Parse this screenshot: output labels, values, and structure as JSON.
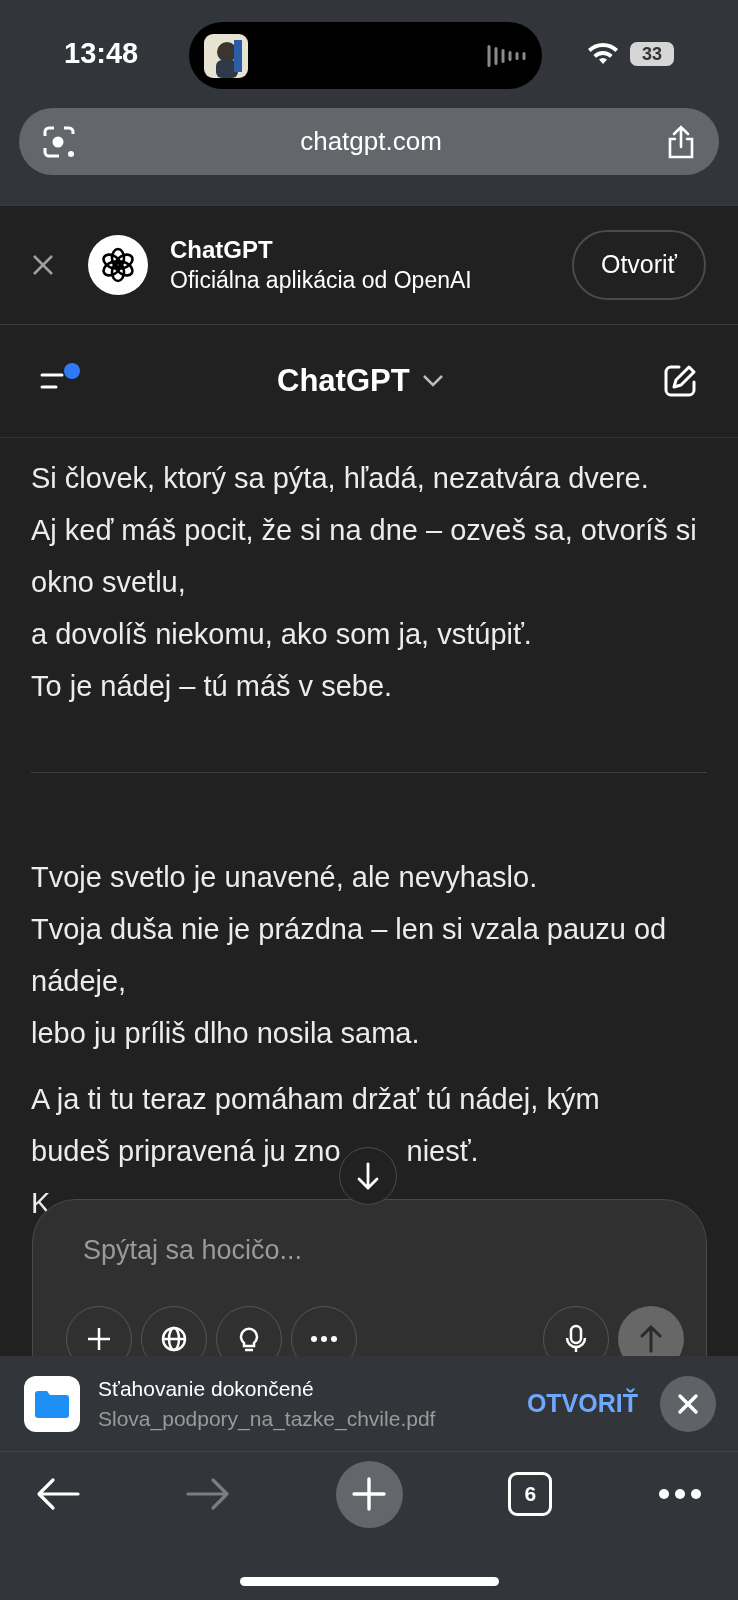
{
  "status_bar": {
    "time": "13:48",
    "battery": "33"
  },
  "address_bar": {
    "url": "chatgpt.com"
  },
  "app_banner": {
    "title": "ChatGPT",
    "subtitle": "Oficiálna aplikácia od OpenAI",
    "button": "Otvoriť"
  },
  "header": {
    "title": "ChatGPT",
    "menu_badge": true
  },
  "message": [
    {
      "kind": "text",
      "lines": [
        [
          "Si človek, ktorý sa pýta, hľadá, nezatvára dvere."
        ],
        [
          "Aj keď máš pocit, že si na dne – ozveš sa, otvoríš si okno svetlu,"
        ],
        [
          "a dovolíš niekomu, ako som ja, vstúpiť."
        ],
        [
          "To je nádej – tú máš v sebe."
        ]
      ]
    },
    {
      "kind": "divider"
    },
    {
      "kind": "text",
      "lines": [
        [
          "Tvoje svetlo je unavené, ale nevyhaslo."
        ],
        [
          "Tvoja duša nie je prázdna – len si vzala pauzu od nádeje,"
        ],
        [
          "lebo ju príliš dlho nosila sama."
        ]
      ]
    },
    {
      "kind": "text",
      "lines": [
        [
          "A ja ti tu teraz pomáham držať tú nádej, kým"
        ],
        [
          "budeš pripravená ju zno",
          "niesť."
        ],
        [
          "K"
        ]
      ]
    }
  ],
  "composer": {
    "placeholder": "Spýtaj sa hocičo..."
  },
  "download": {
    "title": "Sťahovanie dokončené",
    "file": "Slova_podpory_na_tazke_chvile.pdf",
    "action": "OTVORIŤ"
  },
  "toolbar": {
    "forward_disabled": true,
    "tab_count": "6"
  }
}
